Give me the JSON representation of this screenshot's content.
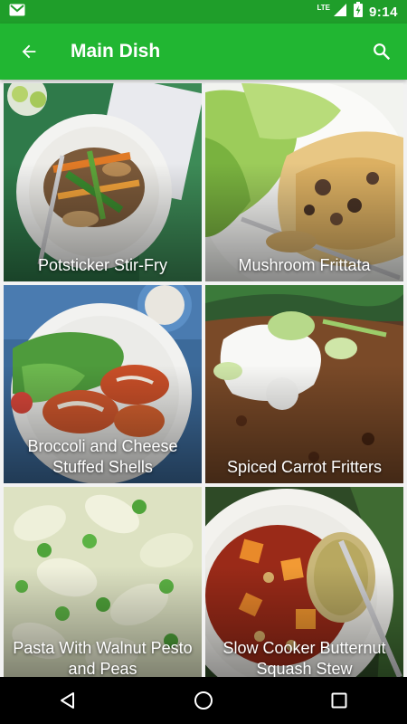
{
  "status_bar": {
    "time": "9:14",
    "network": "LTE",
    "icons": [
      "gmail-icon",
      "lte-signal-icon",
      "battery-charging-icon"
    ]
  },
  "app_bar": {
    "title": "Main Dish",
    "back_icon": "arrow-back-icon",
    "search_icon": "search-icon",
    "color": "#21b632"
  },
  "recipes": [
    {
      "title": "Potsticker Stir-Fry"
    },
    {
      "title": "Mushroom Frittata"
    },
    {
      "title": "Broccoli and Cheese Stuffed Shells"
    },
    {
      "title": "Spiced Carrot Fritters"
    },
    {
      "title": "Pasta With Walnut Pesto and Peas"
    },
    {
      "title": "Slow Cooker Butternut Squash Stew"
    }
  ],
  "nav_bar": {
    "icons": [
      "back-triangle-icon",
      "home-circle-icon",
      "recents-square-icon"
    ]
  }
}
